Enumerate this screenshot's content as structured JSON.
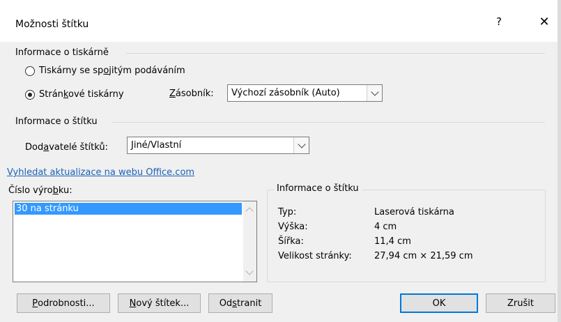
{
  "dialog": {
    "title": "Možnosti štítku",
    "help": "?",
    "close": "✕"
  },
  "printer_info": {
    "group_label": "Informace o tiskárně",
    "continuous_feed": {
      "pre": "Tiskárny se sp",
      "key": "o",
      "post": "jitým podáváním",
      "checked": false
    },
    "page_printers": {
      "pre": "Strán",
      "key": "k",
      "post": "ové tiskárny",
      "checked": true
    },
    "tray_label": {
      "pre": "",
      "key": "Z",
      "post": "ásobník:"
    },
    "tray_value": "Výchozí zásobník (Auto)"
  },
  "label_info": {
    "group_label": "Informace o štítku",
    "vendor_label": {
      "pre": "Dod",
      "key": "a",
      "post": "vatelé štítků:"
    },
    "vendor_value": "Jiné/Vlastní"
  },
  "link_text": "Vyhledat aktualizace na webu Office.com",
  "product_number": {
    "label": {
      "pre": "Číslo výro",
      "key": "b",
      "post": "ku:"
    },
    "items": [
      "30 na stránku"
    ],
    "selected_index": 0
  },
  "details": {
    "title": "Informace o štítku",
    "rows": [
      {
        "key": "Typ:",
        "value": "Laserová tiskárna"
      },
      {
        "key": "Výška:",
        "value": "4 cm"
      },
      {
        "key": "Šířka:",
        "value": "11,4 cm"
      },
      {
        "key": "Velikost stránky:",
        "value": "27,94 cm × 21,59 cm"
      }
    ]
  },
  "buttons": {
    "details": {
      "pre": "",
      "key": "P",
      "post": "odrobnosti..."
    },
    "new_label": {
      "pre": "",
      "key": "N",
      "post": "ový štítek..."
    },
    "delete": {
      "pre": "Od",
      "key": "s",
      "post": "tranit"
    },
    "ok": "OK",
    "cancel": "Zrušit"
  },
  "colors": {
    "selection": "#3399ff",
    "link": "#1a62b8",
    "default_button_border": "#0078d7"
  }
}
